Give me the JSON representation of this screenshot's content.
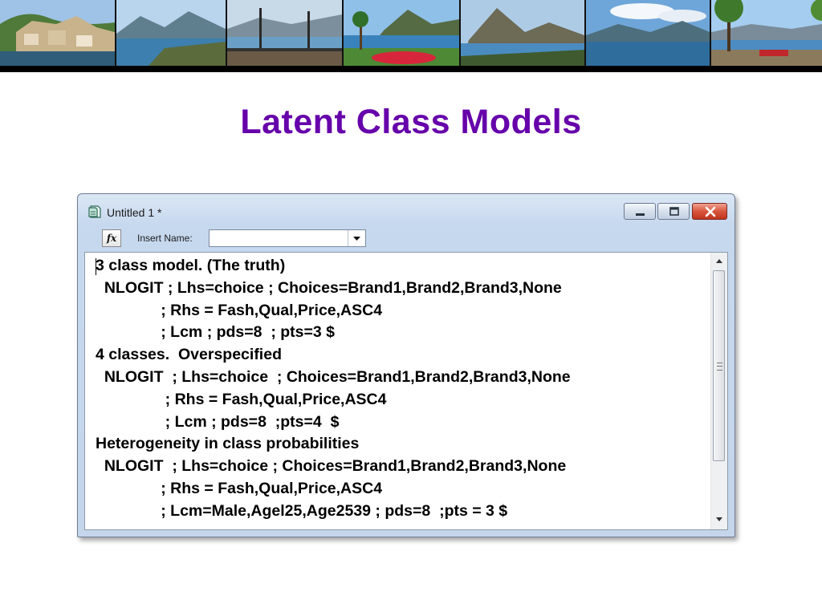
{
  "banner": {
    "photos": [
      "lakeside-village",
      "mountain-lake-view",
      "lake-promenade-lamps",
      "lake-flowerbed-palms",
      "lake-mountain-hill",
      "alpine-lake-clouds",
      "lakeside-park-bench"
    ]
  },
  "slide": {
    "title": "Latent Class Models"
  },
  "window": {
    "title": "Untitled 1 *",
    "controls": [
      "minimize-icon",
      "maximize-icon",
      "close-icon"
    ],
    "toolbar": {
      "fx_label": "fx",
      "insert_name_label": "Insert Name:",
      "insert_name_value": ""
    },
    "editor": {
      "lines": [
        "3 class model. (The truth)",
        "  NLOGIT ; Lhs=choice ; Choices=Brand1,Brand2,Brand3,None",
        "               ; Rhs = Fash,Qual,Price,ASC4",
        "               ; Lcm ; pds=8  ; pts=3 $",
        "4 classes.  Overspecified",
        "  NLOGIT  ; Lhs=choice  ; Choices=Brand1,Brand2,Brand3,None",
        "                ; Rhs = Fash,Qual,Price,ASC4",
        "                ; Lcm ; pds=8  ;pts=4  $",
        "Heterogeneity in class probabilities",
        "  NLOGIT  ; Lhs=choice ; Choices=Brand1,Brand2,Brand3,None",
        "               ; Rhs = Fash,Qual,Price,ASC4",
        "               ; Lcm=Male,Agel25,Age2539 ; pds=8  ;pts = 3 $"
      ]
    }
  },
  "colors": {
    "title": "#6600aa",
    "window_frame": "#c5d6ec",
    "close_button": "#c8402a"
  }
}
